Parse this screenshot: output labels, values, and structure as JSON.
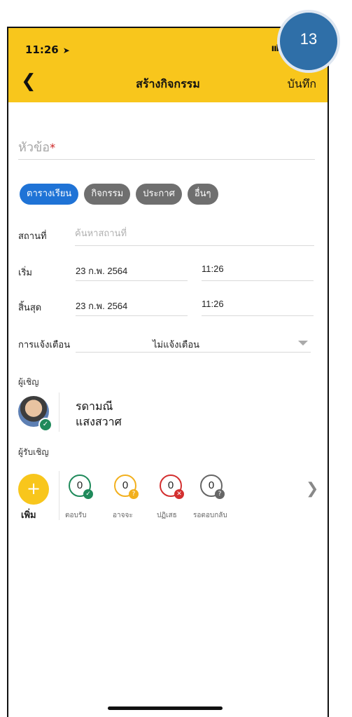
{
  "status_bar": {
    "time": "11:26",
    "signal": "ııl"
  },
  "header": {
    "title": "สร้างกิจกรรม",
    "save_label": "บันทึก",
    "back_icon": "chevron-left-icon"
  },
  "badge": {
    "number": "13"
  },
  "form": {
    "title_placeholder": "หัวข้อ",
    "required_mark": "*",
    "categories": [
      {
        "label": "ตารางเรียน",
        "selected": true
      },
      {
        "label": "กิจกรรม",
        "selected": false
      },
      {
        "label": "ประกาศ",
        "selected": false
      },
      {
        "label": "อื่นๆ",
        "selected": false
      }
    ],
    "place_label": "สถานที่",
    "place_placeholder": "ค้นหาสถานที่",
    "start_label": "เริ่ม",
    "start_date": "23 ก.พ. 2564",
    "start_time": "11:26",
    "end_label": "สิ้นสุด",
    "end_date": "23 ก.พ. 2564",
    "end_time": "11:26",
    "notify_label": "การแจ้งเตือน",
    "notify_value": "ไม่แจ้งเตือน"
  },
  "inviter": {
    "label": "ผู้เชิญ",
    "first_name": "รดามณี",
    "last_name": "แสงสวาศ"
  },
  "invitees": {
    "label": "ผู้รับเชิญ",
    "add_label": "เพิ่ม",
    "statuses": [
      {
        "label": "ตอบรับ",
        "count": "0",
        "color": "#1f8a5b",
        "icon": "check-icon"
      },
      {
        "label": "อาจจะ",
        "count": "0",
        "color": "#f2b01e",
        "icon": "question-icon"
      },
      {
        "label": "ปฏิเสธ",
        "count": "0",
        "color": "#d32f2f",
        "icon": "close-icon"
      },
      {
        "label": "รอตอบกลับ",
        "count": "0",
        "color": "#666666",
        "icon": "question-icon"
      }
    ]
  },
  "colors": {
    "header": "#f8c61c",
    "chip_active": "#1f73d6",
    "chip_inactive": "#6f6f6f"
  }
}
